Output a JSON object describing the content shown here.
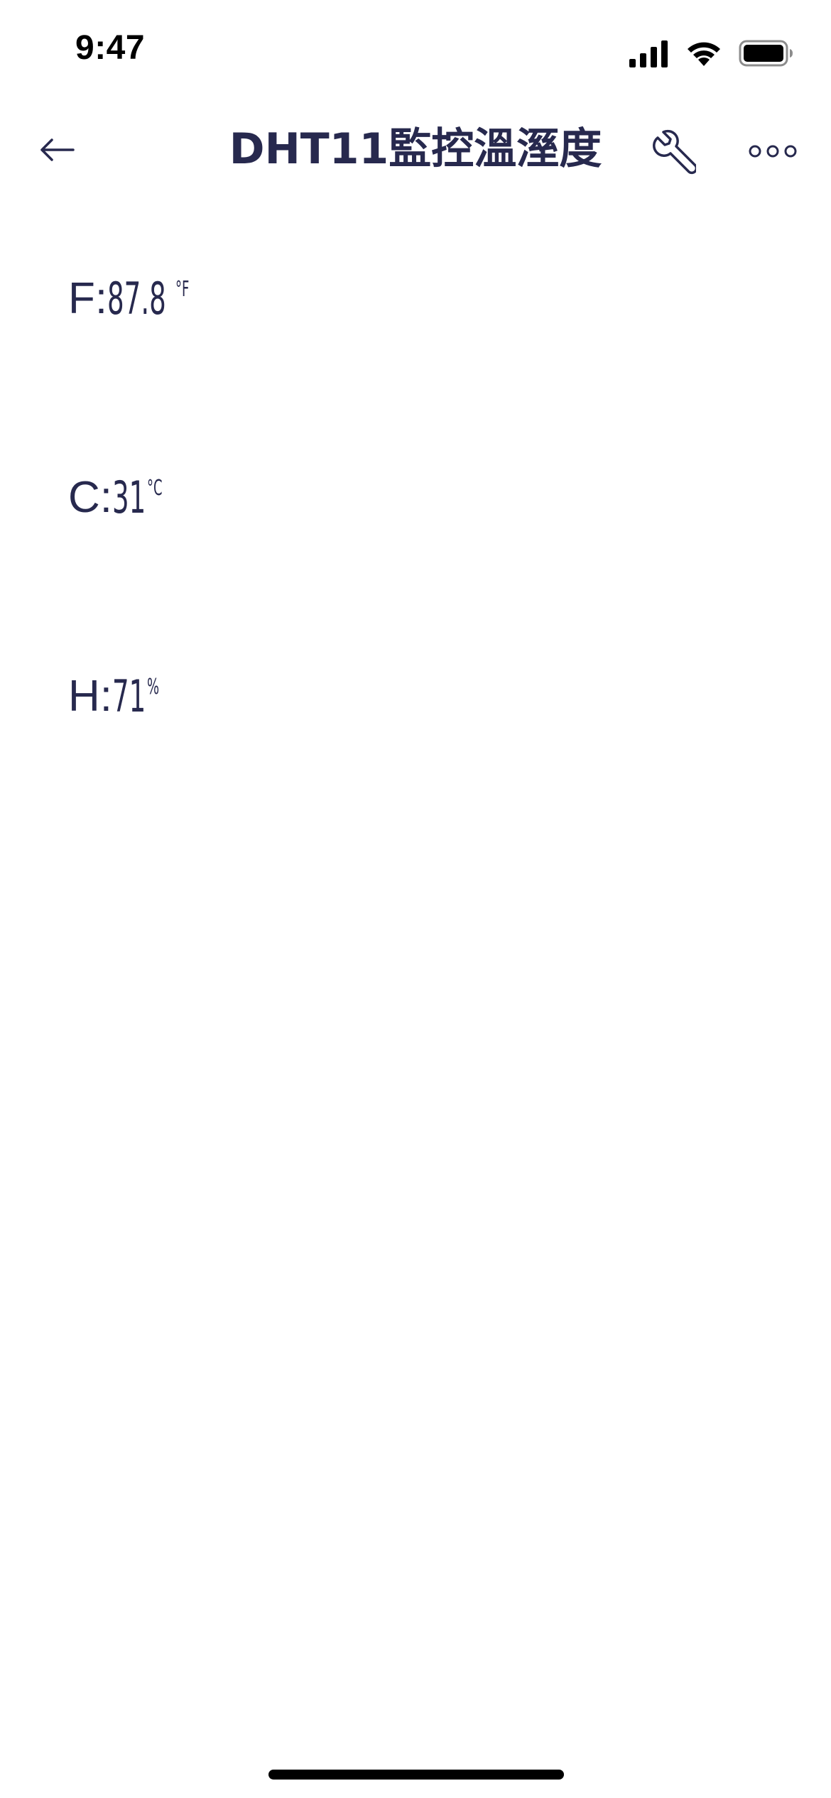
{
  "status_bar": {
    "time": "9:47",
    "icons": [
      "cellular-signal-icon",
      "wifi-icon",
      "battery-icon"
    ]
  },
  "header": {
    "title": "DHT11監控溫溼度",
    "back_icon": "arrow-left-icon",
    "settings_icon": "wrench-icon",
    "more_icon": "more-horizontal-icon"
  },
  "widgets": [
    {
      "label": "F:",
      "value": "87.8",
      "unit": "°F"
    },
    {
      "label": "C:",
      "value": "31",
      "unit": "°C"
    },
    {
      "label": "H:",
      "value": "71",
      "unit": "%"
    }
  ],
  "colors": {
    "text_primary": "#27294e",
    "background": "#ffffff"
  }
}
